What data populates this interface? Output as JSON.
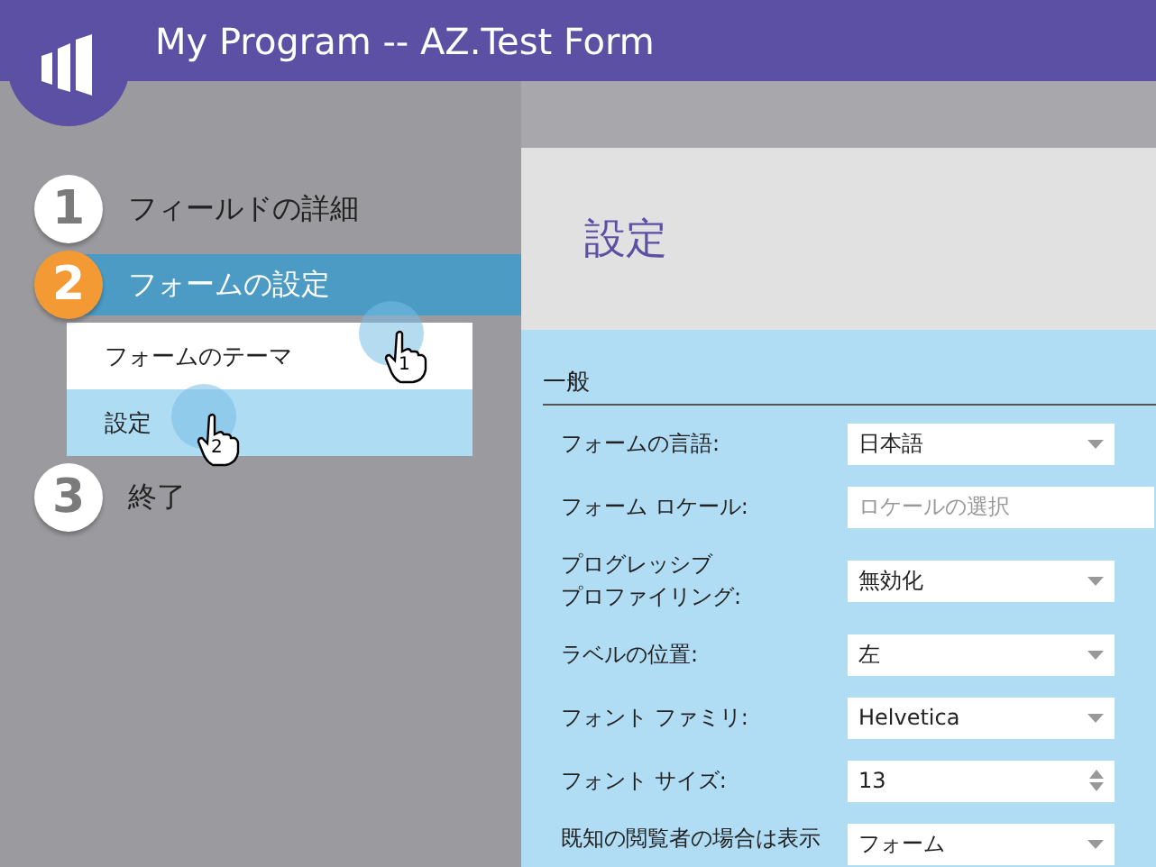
{
  "window": {
    "title": "My Program -- AZ.Test Form"
  },
  "steps": [
    {
      "number": "1",
      "label": "フィールドの詳細",
      "selected": false
    },
    {
      "number": "2",
      "label": "フォームの設定",
      "selected": true,
      "children": [
        {
          "label": "フォームのテーマ",
          "selected": false,
          "click": "1"
        },
        {
          "label": "設定",
          "selected": true,
          "click": "2"
        }
      ]
    },
    {
      "number": "3",
      "label": "終了",
      "selected": false
    }
  ],
  "page": {
    "title": "設定"
  },
  "section": {
    "title": "一般"
  },
  "fields": [
    {
      "label": "フォームの言語:",
      "kind": "select",
      "value": "日本語"
    },
    {
      "label": "フォーム ロケール:",
      "kind": "text",
      "placeholder": "ロケールの選択"
    },
    {
      "label": [
        "プログレッシブ",
        "プロファイリング:"
      ],
      "kind": "select",
      "value": "無効化"
    },
    {
      "label": "ラベルの位置:",
      "kind": "select",
      "value": "左"
    },
    {
      "label": "フォント ファミリ:",
      "kind": "select",
      "value": "Helvetica"
    },
    {
      "label": "フォント サイズ:",
      "kind": "spinner",
      "value": "13"
    },
    {
      "label": "既知の閲覧者の場合は表示",
      "kind": "select",
      "value": "フォーム"
    }
  ]
}
